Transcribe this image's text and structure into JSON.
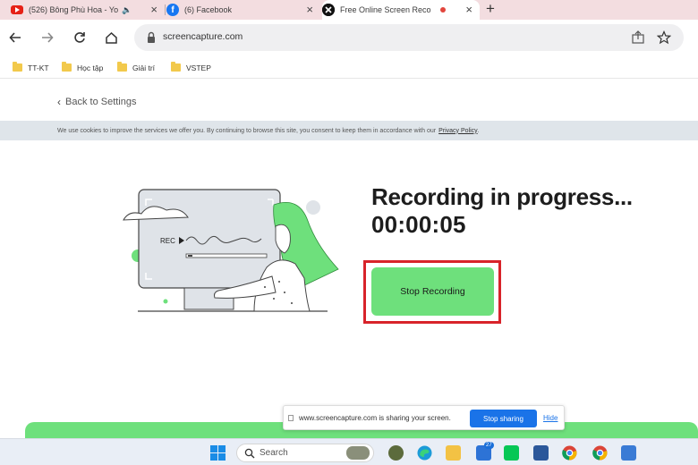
{
  "browser": {
    "tabs": [
      {
        "title": "(526) Bông Phù Hoa - Yo",
        "icon": "youtube-icon",
        "active": false
      },
      {
        "title": "(6) Facebook",
        "icon": "facebook-icon",
        "active": false
      },
      {
        "title": "Free Online Screen Reco",
        "icon": "screencapture-icon",
        "active": true
      }
    ],
    "url": "screencapture.com",
    "bookmarks": [
      "TT-KT",
      "Học tập",
      "Giải trí",
      "VSTEP"
    ]
  },
  "page": {
    "back_link": "Back to Settings",
    "cookie_text": "We use cookies to improve the services we offer you. By continuing to browse this site, you consent to keep them in accordance with our",
    "cookie_link": "Privacy Policy",
    "cookie_end": ".",
    "status_title": "Recording in progress...",
    "timer": "00:00:05",
    "stop_button": "Stop Recording",
    "illustration_rec_label": "REC"
  },
  "share_bar": {
    "message": "www.screencapture.com is sharing your screen.",
    "stop_sharing": "Stop sharing",
    "hide": "Hide"
  },
  "taskbar": {
    "search_placeholder": "Search",
    "badge": "27"
  },
  "colors": {
    "accent_green": "#6ee07c",
    "highlight_red": "#d8232a",
    "tabstrip": "#f3dde0",
    "link_blue": "#1a73e8"
  }
}
